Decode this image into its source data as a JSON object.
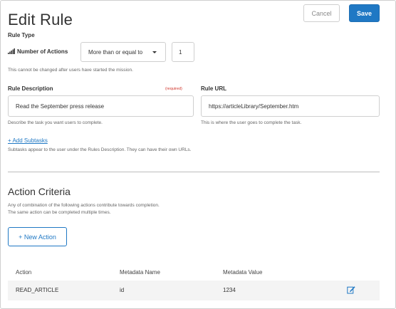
{
  "header": {
    "title": "Edit Rule",
    "cancel_label": "Cancel",
    "save_label": "Save"
  },
  "rule_type": {
    "label": "Rule Type",
    "number_of_actions_label": "Number of Actions",
    "comparison_value": "More than or equal to",
    "count_value": "1",
    "hint": "This cannot be changed after users have started the mission."
  },
  "rule_description": {
    "label": "Rule Description",
    "required_label": "(required)",
    "value": "Read the September press release",
    "hint": "Describe the task you want users to complete."
  },
  "rule_url": {
    "label": "Rule URL",
    "value": "https://articleLibrary/September.htm",
    "hint": "This is where the user goes to complete the task."
  },
  "subtasks": {
    "link_label": "+ Add Subtasks",
    "hint": "Subtasks appear to the user under the Rules Description. They can have their own URLs."
  },
  "action_criteria": {
    "title": "Action Criteria",
    "hint_line1": "Any of combination of the following actions contribute towards completion.",
    "hint_line2": "The same action can be completed multiple times.",
    "new_action_label": "+ New Action"
  },
  "table": {
    "columns": [
      "Action",
      "Metadata Name",
      "Metadata Value"
    ],
    "rows": [
      {
        "action": "READ_ARTICLE",
        "metadata_name": "id",
        "metadata_value": "1234"
      }
    ]
  },
  "colors": {
    "accent": "#1f78c4",
    "required": "#d0352b",
    "row_background": "#f4f4f4"
  },
  "icons": {
    "signal": "signal-bars-icon",
    "caret": "caret-down-icon",
    "edit": "edit-icon"
  }
}
